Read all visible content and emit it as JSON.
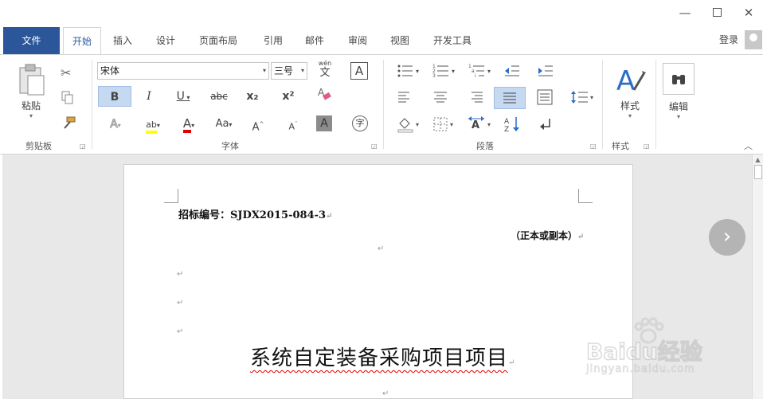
{
  "tabs": [
    "文件",
    "开始",
    "插入",
    "设计",
    "页面布局",
    "引用",
    "邮件",
    "审阅",
    "视图",
    "开发工具"
  ],
  "login": "登录",
  "ribbon": {
    "clipboard": {
      "paste": "粘贴",
      "label": "剪贴板"
    },
    "font": {
      "name": "宋体",
      "size": "三号",
      "label": "字体",
      "wen_top": "wén",
      "wen_char": "文",
      "boxed_a": "A",
      "bold": "B",
      "italic": "I",
      "underline": "U",
      "strike": "abc",
      "subscript": "x₂",
      "superscript": "x²",
      "effect_a": "A",
      "highlight": "ab",
      "font_color": "A",
      "case": "Aa",
      "grow": "A",
      "shrink": "A",
      "shade_a": "A",
      "enclose": "字"
    },
    "paragraph": {
      "label": "段落"
    },
    "styles": {
      "button": "样式",
      "label": "样式"
    },
    "editing": {
      "button": "编辑"
    }
  },
  "document": {
    "bid_number": "招标编号：SJDX2015-084-3",
    "original_copy": "（正本或副本）",
    "title": "系统自定装备采购项目项目",
    "paragraph_mark": "↵"
  },
  "watermark": {
    "brand": "Baidu经验",
    "url": "jingyan.baidu.com"
  },
  "colors": {
    "accent": "#2b579a",
    "font_color_bar": "#e00000",
    "highlight_bar": "#ffff00"
  }
}
